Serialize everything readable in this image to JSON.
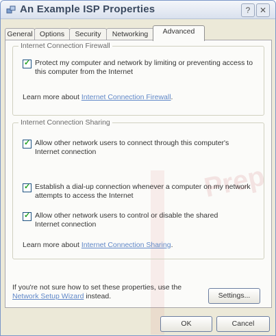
{
  "window": {
    "title": "An Example ISP Properties",
    "help_label": "?",
    "close_label": "✕"
  },
  "tabs": [
    {
      "label": "General"
    },
    {
      "label": "Options"
    },
    {
      "label": "Security"
    },
    {
      "label": "Networking"
    },
    {
      "label": "Advanced",
      "active": true
    }
  ],
  "firewall": {
    "legend": "Internet Connection Firewall",
    "option_text": "Protect my computer and network by limiting or preventing access to this computer from the Internet",
    "learn_prefix": "Learn more about",
    "learn_link": "Internet Connection Firewall",
    "learn_suffix": "."
  },
  "sharing": {
    "legend": "Internet Connection Sharing",
    "options": [
      {
        "text": "Allow other network users to connect through this computer's Internet connection"
      },
      {
        "text": "Establish a dial-up connection whenever a computer on my network attempts to access the Internet"
      },
      {
        "text": "Allow other network users to control or disable the shared Internet connection"
      }
    ],
    "learn_prefix": "Learn more about",
    "learn_link": "Internet Connection Sharing",
    "learn_suffix": "."
  },
  "footer": {
    "help_prefix": "If you're not sure how to set these properties, use the",
    "help_link": "Network Setup Wizard",
    "help_suffix": "instead.",
    "settings_label": "Settings..."
  },
  "dialog_buttons": {
    "ok_label": "OK",
    "cancel_label": "Cancel"
  },
  "watermark_text": "Prep"
}
